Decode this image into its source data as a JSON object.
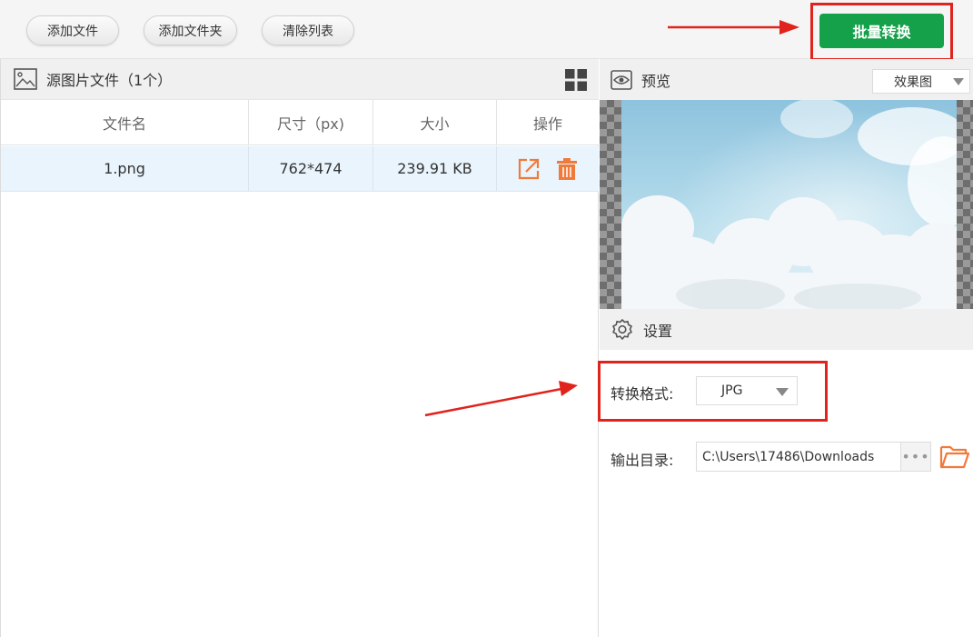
{
  "toolbar": {
    "add_file": "添加文件",
    "add_folder": "添加文件夹",
    "clear_list": "清除列表",
    "batch_convert": "批量转换"
  },
  "source_panel": {
    "title": "源图片文件（1个）",
    "columns": [
      "文件名",
      "尺寸（px)",
      "大小",
      "操作"
    ],
    "rows": [
      {
        "name": "1.png",
        "dimensions": "762*474",
        "size": "239.91 KB"
      }
    ]
  },
  "preview": {
    "title": "预览",
    "mode_selected": "效果图"
  },
  "settings": {
    "title": "设置",
    "format_label": "转换格式:",
    "format_value": "JPG",
    "output_label": "输出目录:",
    "output_path": "C:\\Users\\17486\\Downloads",
    "more_label": "•••"
  },
  "icons": {
    "header": "image-icon",
    "view_toggle": "grid-view-icon",
    "open": "open-external-icon",
    "delete": "trash-icon",
    "preview": "eye-icon",
    "settings": "gear-icon",
    "folder": "folder-open-icon"
  },
  "colors": {
    "convert_button": "#15a04a",
    "highlight": "#e0231c",
    "action_icon": "#f07a3a",
    "selected_row": "#e9f4fc"
  }
}
